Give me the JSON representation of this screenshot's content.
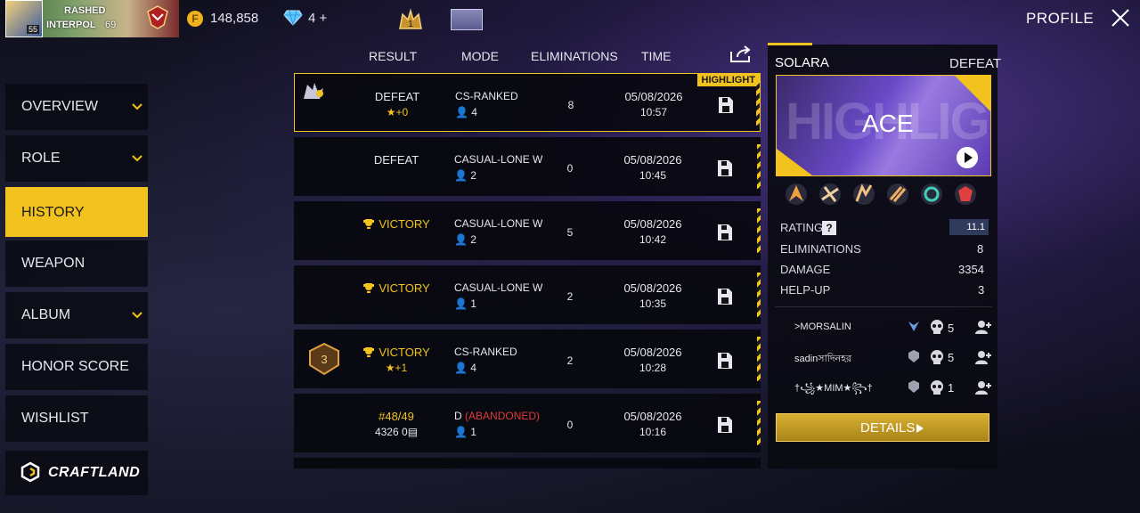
{
  "player": {
    "name": "RASHED",
    "guild": "INTERPOL",
    "level": "69",
    "avatar_level": "55"
  },
  "currency": {
    "gold": "148,858",
    "diamonds": "4 +"
  },
  "header": {
    "crown_value": "1",
    "profile_label": "PROFILE"
  },
  "menu": {
    "items": [
      {
        "label": "OVERVIEW",
        "has_chevron": true
      },
      {
        "label": "ROLE",
        "has_chevron": true
      },
      {
        "label": "HISTORY",
        "has_chevron": false,
        "active": true
      },
      {
        "label": "WEAPON",
        "has_chevron": false
      },
      {
        "label": "ALBUM",
        "has_chevron": true
      },
      {
        "label": "HONOR SCORE",
        "has_chevron": false
      },
      {
        "label": "WISHLIST",
        "has_chevron": false
      }
    ],
    "craftland": "CRAFTLAND"
  },
  "table": {
    "headers": {
      "result": "RESULT",
      "mode": "MODE",
      "eliminations": "ELIMINATIONS",
      "time": "TIME"
    },
    "rows": [
      {
        "result": "DEFEAT",
        "sub": "+0",
        "mode": "CS-RANKED",
        "squad": "4",
        "elim": "8",
        "date": "05/08/2026",
        "time": "10:57",
        "highlight": "HIGHLIGHT"
      },
      {
        "result": "DEFEAT",
        "sub": "",
        "mode": "CASUAL-LONE W",
        "squad": "2",
        "elim": "0",
        "date": "05/08/2026",
        "time": "10:45"
      },
      {
        "result": "VICTORY",
        "sub": "",
        "mode": "CASUAL-LONE W",
        "squad": "2",
        "elim": "5",
        "date": "05/08/2026",
        "time": "10:42"
      },
      {
        "result": "VICTORY",
        "sub": "",
        "mode": "CASUAL-LONE W",
        "squad": "1",
        "elim": "2",
        "date": "05/08/2026",
        "time": "10:35"
      },
      {
        "result": "VICTORY",
        "sub": "+1",
        "mode": "CS-RANKED",
        "squad": "4",
        "elim": "2",
        "date": "05/08/2026",
        "time": "10:28",
        "rank_badge": "3"
      },
      {
        "result": "#48/49",
        "sub": "4326",
        "sub2": "0",
        "mode": "D",
        "mode_status": "(ABANDONED)",
        "squad": "1",
        "elim": "0",
        "date": "05/08/2026",
        "time": "10:16"
      }
    ]
  },
  "detail": {
    "map": "SOLARA",
    "result": "DEFEAT",
    "highlight_title": "ACE",
    "stats": {
      "rating_label": "RATING",
      "rating_value": "11.1",
      "elim_label": "ELIMINATIONS",
      "elim_value": "8",
      "damage_label": "DAMAGE",
      "damage_value": "3354",
      "helpup_label": "HELP-UP",
      "helpup_value": "3"
    },
    "teammates": [
      {
        "name": ">MORSALIN",
        "kills": "5"
      },
      {
        "name": "sadinসাদিনহর",
        "kills": "5"
      },
      {
        "name": "†꧁★MIM★꧂†",
        "kills": "1"
      }
    ],
    "details_label": "DETAILS"
  },
  "colors": {
    "accent": "#f2c21e",
    "abandoned": "#e03a3a"
  }
}
